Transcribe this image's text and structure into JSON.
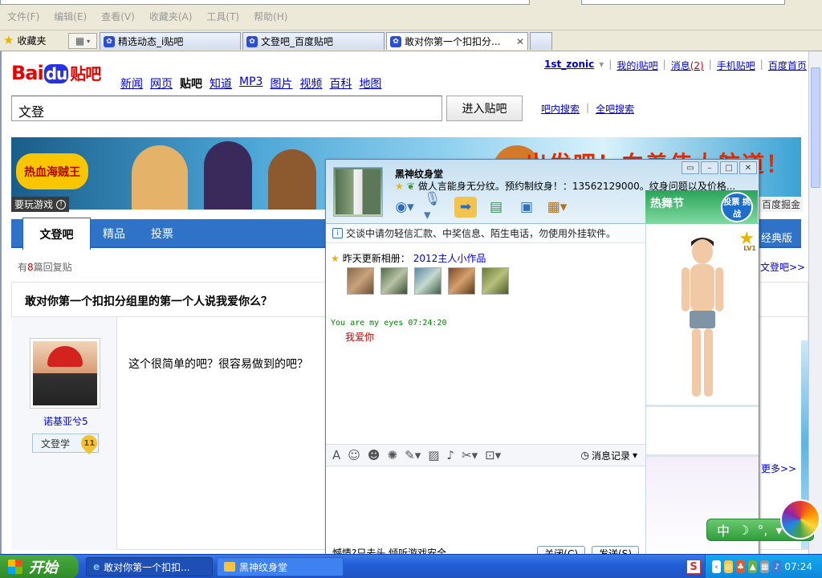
{
  "browser": {
    "menus": [
      "文件(F)",
      "编辑(E)",
      "查看(V)",
      "收藏夹(A)",
      "工具(T)",
      "帮助(H)"
    ],
    "favorites_label": "收藏夹",
    "tabs": [
      {
        "label": "精选动态_i贴吧"
      },
      {
        "label": "文登吧_百度贴吧"
      },
      {
        "label": "敢对你第一个扣扣分..."
      }
    ],
    "close_glyph": "✕"
  },
  "tieba": {
    "logo": {
      "bai": "Bai",
      "du": "du",
      "tieba": "贴吧"
    },
    "nav": [
      "新闻",
      "网页",
      "贴吧",
      "知道",
      "MP3",
      "图片",
      "视频",
      "百科",
      "地图"
    ],
    "nav_current": "贴吧",
    "user_links": {
      "username": "1st_zonic",
      "my_tieba": "我的i贴吧",
      "messages": "消息",
      "message_count": "(2)",
      "mobile": "手机贴吧",
      "home": "百度首页"
    },
    "search_value": "文登",
    "search_button": "进入贴吧",
    "search_in_bar": "吧内搜索",
    "search_all": "全吧搜索",
    "banner_title": "出发吧！向着伟大航道！",
    "banner_game": "热血海贼王",
    "play_game": "要玩游戏",
    "baidu_miner": "百度掘金",
    "tabs": [
      "文登吧",
      "精品",
      "投票"
    ],
    "classic_link": "经典版",
    "reply_prefix": "有",
    "reply_count": "8",
    "reply_suffix": "篇回复贴",
    "to_bar_link": "文登吧>>",
    "thread_title": "敢对你第一个扣扣分组里的第一个人说我爱你么？",
    "post_user": "诺基亚兮5",
    "post_user_title": "文登学",
    "post_user_level": "11",
    "post_text": "这个很简单的吧？很容易做到的吧？",
    "more_link": "更多>>"
  },
  "qq": {
    "contact_name": "黑神纹身堂",
    "signature": "做人言能身无分纹。预约制纹身！：13562129000。纹身问题以及价格...",
    "ad_text": "热舞节",
    "ad_button": "投票 挑战",
    "notice": "交谈中请勿轻信汇款、中奖信息、陌生电话，勿使用外挂软件。",
    "album_prefix": "昨天更新相册：",
    "album_link": "2012主人小作品",
    "msg_header": "You are my eyes  07:24:20",
    "msg_body": "我爱你",
    "history": "消息记录",
    "bottom_status": "憾情?只去头  倾听游戏安全",
    "close_btn": "关闭(C)",
    "send_btn": "发送(S)",
    "level_badge": "LV1"
  },
  "ime": {
    "label": "中",
    "moon": "☽",
    "dot": "°,"
  },
  "taskbar": {
    "start": "开始",
    "tasks": [
      "敢对你第一个扣扣...",
      "黑神纹身堂"
    ],
    "clock": "07:24"
  }
}
